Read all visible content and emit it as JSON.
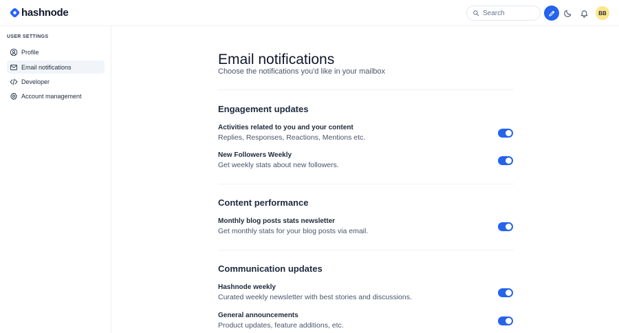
{
  "brand": {
    "name": "hashnode",
    "color": "#2962ff"
  },
  "header": {
    "search_placeholder": "Search",
    "avatar_initials": "BB",
    "accent": "#2563eb"
  },
  "sidebar": {
    "heading": "USER SETTINGS",
    "items": [
      {
        "label": "Profile",
        "icon": "user-circle-icon",
        "active": false
      },
      {
        "label": "Email notifications",
        "icon": "mail-icon",
        "active": true
      },
      {
        "label": "Developer",
        "icon": "code-icon",
        "active": false
      },
      {
        "label": "Account management",
        "icon": "gear-icon",
        "active": false
      }
    ]
  },
  "main": {
    "title": "Email notifications",
    "subtitle": "Choose the notifications you'd like in your mailbox",
    "sections": [
      {
        "title": "Engagement updates",
        "settings": [
          {
            "title": "Activities related to you and your content",
            "desc": "Replies, Responses, Reactions, Mentions etc.",
            "enabled": true
          },
          {
            "title": "New Followers Weekly",
            "desc": "Get weekly stats about new followers.",
            "enabled": true
          }
        ]
      },
      {
        "title": "Content performance",
        "settings": [
          {
            "title": "Monthly blog posts stats newsletter",
            "desc": "Get monthly stats for your blog posts via email.",
            "enabled": true
          }
        ]
      },
      {
        "title": "Communication updates",
        "settings": [
          {
            "title": "Hashnode weekly",
            "desc": "Curated weekly newsletter with best stories and discussions.",
            "enabled": true
          },
          {
            "title": "General announcements",
            "desc": "Product updates, feature additions, etc.",
            "enabled": true
          }
        ]
      }
    ]
  }
}
